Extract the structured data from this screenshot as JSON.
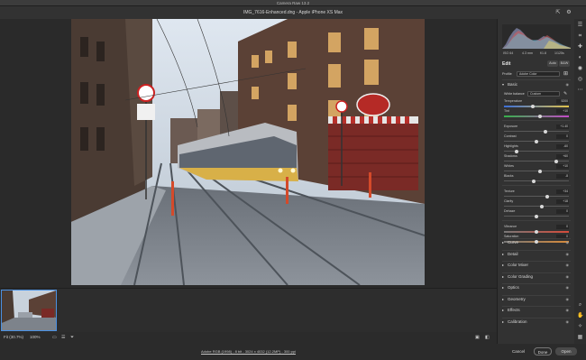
{
  "window": {
    "title": "Camera Raw 13.2"
  },
  "header": {
    "file_title": "IMG_7616-Enhanced.dng",
    "camera": "Apple iPhone XS Max"
  },
  "camera_info": [
    "ISO 64",
    "4.3 mm",
    "f/1.8",
    "1/125s"
  ],
  "edit": {
    "label": "Edit",
    "auto_label": "Auto",
    "bw_label": "B&W",
    "profile_label": "Profile",
    "profile_value": "Adobe Color",
    "basic_label": "Basic",
    "white_balance_label": "White balance",
    "white_balance_value": "Custom"
  },
  "sliders": [
    {
      "id": "temperature",
      "label": "Temperature",
      "value": "5200",
      "pos": 0.45,
      "gradient": "linear-gradient(90deg,#3c6fd8,#e0c24a)"
    },
    {
      "id": "tint",
      "label": "Tint",
      "value": "+10",
      "pos": 0.55,
      "gradient": "linear-gradient(90deg,#35b04a,#c44ac7)"
    },
    {
      "id": "exposure",
      "label": "Exposure",
      "value": "+1.40",
      "pos": 0.64
    },
    {
      "id": "contrast",
      "label": "Contrast",
      "value": "0",
      "pos": 0.5
    },
    {
      "id": "highlights",
      "label": "Highlights",
      "value": "-60",
      "pos": 0.2
    },
    {
      "id": "shadows",
      "label": "Shadows",
      "value": "+60",
      "pos": 0.8
    },
    {
      "id": "whites",
      "label": "Whites",
      "value": "+10",
      "pos": 0.55
    },
    {
      "id": "blacks",
      "label": "Blacks",
      "value": "-8",
      "pos": 0.46
    },
    {
      "id": "texture",
      "label": "Texture",
      "value": "+34",
      "pos": 0.67
    },
    {
      "id": "clarity",
      "label": "Clarity",
      "value": "+18",
      "pos": 0.59
    },
    {
      "id": "dehaze",
      "label": "Dehaze",
      "value": "0",
      "pos": 0.5
    },
    {
      "id": "vibrance",
      "label": "Vibrance",
      "value": "0",
      "pos": 0.5,
      "gradient": "linear-gradient(90deg,#777,#d54b3a)"
    },
    {
      "id": "saturation",
      "label": "Saturation",
      "value": "0",
      "pos": 0.5,
      "gradient": "linear-gradient(90deg,#777,#d88a3a)"
    }
  ],
  "sections": [
    "Curve",
    "Detail",
    "Color Mixer",
    "Color Grading",
    "Optics",
    "Geometry",
    "Effects",
    "Calibration"
  ],
  "statusbar": {
    "fit_label": "Fit (30.7%)",
    "zoom": "100%"
  },
  "footer": {
    "workflow_link": "Adobe RGB (1998) - 8 bit - 3024 x 4032 (12.2MP) - 300 ppi",
    "cancel": "Cancel",
    "done": "Done",
    "open": "Open"
  },
  "icons": {
    "fullscreen": "fullscreen-icon",
    "settings": "gear-icon",
    "tools": [
      "edit-icon",
      "crop-icon",
      "heal-icon",
      "mask-icon",
      "redeye-icon",
      "presets-icon",
      "more-icon"
    ],
    "zoom": "zoom-icon",
    "hand": "hand-icon",
    "sampler": "sampler-icon",
    "grid": "grid-icon"
  },
  "colors": {
    "accent": "#4a90e2",
    "panel": "#323232",
    "canvas": "#2a2a2a"
  }
}
